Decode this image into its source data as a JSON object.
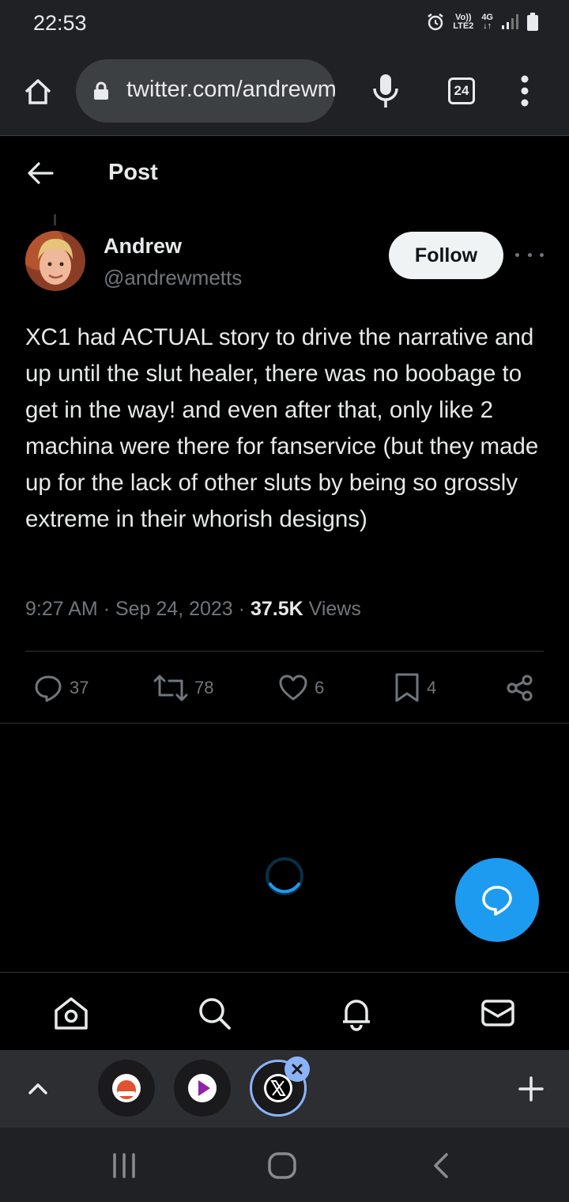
{
  "status_bar": {
    "time": "22:53",
    "network_top": "Vo))",
    "network_bottom": "LTE2",
    "network_type": "4G"
  },
  "browser": {
    "url": "twitter.com/andrewmetts/status",
    "tab_count": "24"
  },
  "header": {
    "title": "Post"
  },
  "post": {
    "author_name": "Andrew",
    "author_handle": "@andrewmetts",
    "follow_label": "Follow",
    "text": "XC1 had ACTUAL story to drive the narrative and up until the slut healer, there was no boobage to get in the way! and even after that, only like 2 machina were there for fanservice (but they made up for the lack of other sluts by being so grossly extreme in their whorish designs)",
    "time": "9:27 AM",
    "date": "Sep 24, 2023",
    "views_count": "37.5K",
    "views_label": "Views",
    "separator": "·",
    "stats": {
      "replies": "37",
      "reposts": "78",
      "likes": "6",
      "bookmarks": "4"
    }
  },
  "colors": {
    "accent": "#1d9bf0",
    "background": "#000000",
    "text_primary": "#e7e9ea",
    "text_secondary": "#71767b",
    "browser_chrome": "#202124"
  }
}
